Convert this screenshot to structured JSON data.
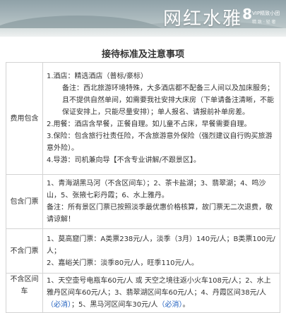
{
  "banner": {
    "brand": "网红水雅",
    "brand_num": "8",
    "brand_tag": "VIP精致小团",
    "brand_tag2": "精 致 · 轻 奢"
  },
  "title": "接待标准及注意事项",
  "rows": [
    {
      "category": "费用包含",
      "lines": [
        "1.酒店：精选酒店（普标/豪标）",
        "备注：西北旅游环境特殊，大多酒店都不配备三人间以及加床服务；且不提供自然单间，如需要我社安排大床房（下单请备注清晰，不能保证安排上，只能尽量安排）；单人报名、请报前补单房差。",
        "2.用餐：酒店含早餐，正餐自理。如儿童不占床，早餐需要自理。",
        "3.保险：包含旅行社责任险，不含旅游意外保险（强烈建议自行购买旅游意外险）。",
        "4.导游：司机兼向导【不含专业讲解/不跟景区】。"
      ]
    },
    {
      "category": "包含门票",
      "lines": [
        "1、青海湖黑马河（不含区间车）；2、茶卡盐湖；3、翡翠湖；4、鸣沙山，5、张掖七彩丹霞；6、水上雅丹。",
        "备注：所有景区门票已按照淡季最优惠价格核算，故门票无二次退费，敬请谅解！"
      ]
    },
    {
      "category": "不含门票",
      "lines": [
        "1、莫高窟门票：A类票238元/人，淡季（3月）140元/人；B类票100元/人；",
        "2、嘉峪关门票：淡季80元/人，旺季110元/人。"
      ]
    },
    {
      "category": "不含区间车",
      "line1": "1、天空壶号电瓶车60元/人 或 天空之境往返小火车108元/人；2、水上雅丹区间车60元/人；3、翡翠湖区间车60元/人；4、丹霞区间38元/人",
      "line1_link": "（必消）",
      "line1_tail": "；5、黑马河区间车30元/人",
      "line1_link2": "（必消）",
      "line1_end": "。"
    }
  ]
}
